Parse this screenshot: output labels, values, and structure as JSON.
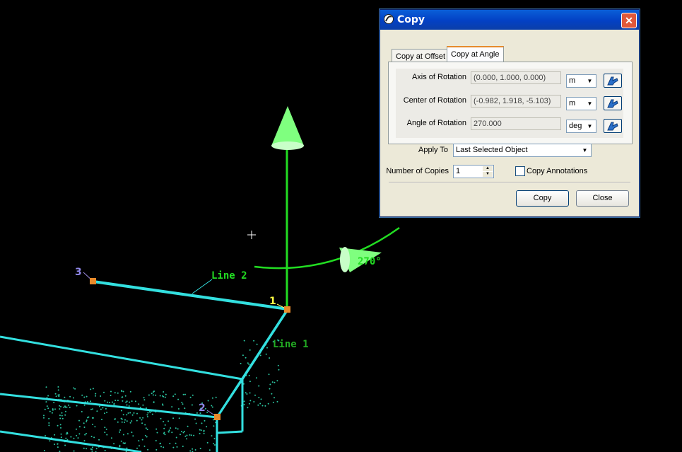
{
  "viewport": {
    "angle_label": "270°",
    "line1_label": "Line 1",
    "line2_label": "Line 2",
    "point1_label": "1",
    "point2_label": "2",
    "point3_label": "3",
    "colors": {
      "background": "#000000",
      "lines": "#33e0e0",
      "axis": "#22dd22",
      "points": "#e88a2a",
      "cloud": "#2bc4a0"
    }
  },
  "dialog": {
    "title": "Copy",
    "tabs": [
      {
        "label": "Copy at Offset",
        "selected": false
      },
      {
        "label": "Copy at Angle",
        "selected": true
      }
    ],
    "fields": [
      {
        "label": "Axis of Rotation",
        "value": "(0.000, 1.000, 0.000)",
        "unit": "m"
      },
      {
        "label": "Center of Rotation",
        "value": "(-0.982, 1.918, -5.103)",
        "unit": "m"
      },
      {
        "label": "Angle of Rotation",
        "value": "270.000",
        "unit": "deg"
      }
    ],
    "apply_to": {
      "label": "Apply To",
      "value": "Last Selected Object"
    },
    "copies": {
      "label": "Number of Copies",
      "value": "1"
    },
    "copy_annotations": {
      "label": "Copy Annotations",
      "checked": false
    },
    "buttons": {
      "copy": "Copy",
      "close": "Close"
    }
  }
}
